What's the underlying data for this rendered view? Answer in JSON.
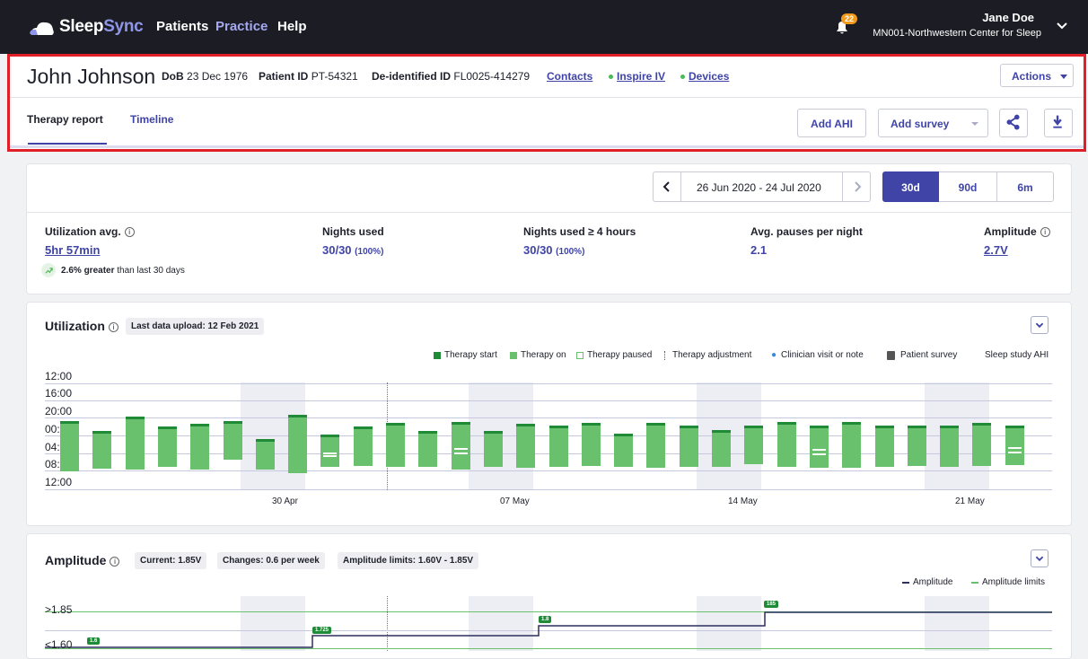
{
  "topbar": {
    "brand_a": "Sleep",
    "brand_b": "Sync",
    "nav": [
      "Patients",
      "Practice",
      "Help"
    ],
    "notifications": "22",
    "user_name": "Jane Doe",
    "user_org": "MN001-Northwestern Center for Sleep"
  },
  "patient": {
    "name": "John Johnson",
    "dob_label": "DoB",
    "dob": "23 Dec 1976",
    "pid_label": "Patient ID",
    "pid": "PT-54321",
    "deid_label": "De-identified ID",
    "deid": "FL0025-414279",
    "links": [
      "Contacts",
      "Inspire IV",
      "Devices"
    ],
    "actions": "Actions",
    "tabs": [
      "Therapy report",
      "Timeline"
    ],
    "add_ahi": "Add AHI",
    "add_survey": "Add survey",
    "colors": {
      "accent": "#3f44a6",
      "highlight": "#e01f26",
      "status_dot": "#4fb859"
    }
  },
  "range": {
    "text": "26 Jun 2020 - 24 Jul 2020",
    "periods": [
      "30d",
      "90d",
      "6m"
    ],
    "selected": "30d"
  },
  "stats": {
    "util_label": "Utilization avg.",
    "util_value": "5hr 57min",
    "trend_bold": "2.6% greater",
    "trend_rest": "than last 30 days",
    "nights_label": "Nights used",
    "nights_value": "30/30",
    "nights_pct": "(100%)",
    "nights4_label": "Nights used ≥ 4 hours",
    "nights4_value": "30/30",
    "nights4_pct": "(100%)",
    "pauses_label": "Avg. pauses per night",
    "pauses_value": "2.1",
    "amp_label": "Amplitude",
    "amp_value": "2.7V"
  },
  "utilization": {
    "title": "Utilization",
    "upload": "Last data upload: 12 Feb 2021",
    "legend": [
      "Therapy start",
      "Therapy on",
      "Therapy paused",
      "Therapy adjustment",
      "Clinician visit or note",
      "Patient survey",
      "Sleep study AHI"
    ],
    "y_ticks": [
      "12:00",
      "16:00",
      "20:00",
      "00:00",
      "04:00",
      "08:00",
      "12:00"
    ],
    "x_ticks": [
      "30 Apr",
      "07 May",
      "14 May",
      "21 May"
    ],
    "colors": {
      "therapy_start": "#1f8b36",
      "therapy_on": "#69c06d"
    }
  },
  "amplitude": {
    "title": "Amplitude",
    "current": "Current: 1.85V",
    "changes": "Changes: 0.6 per week",
    "limits": "Amplitude limits: 1.60V - 1.85V",
    "legend": [
      "Amplitude",
      "Amplitude limits"
    ],
    "y_ticks": [
      ">1.85",
      "<1.60"
    ],
    "tags": [
      "1.6",
      "1.725",
      "1.8",
      "185"
    ]
  }
}
